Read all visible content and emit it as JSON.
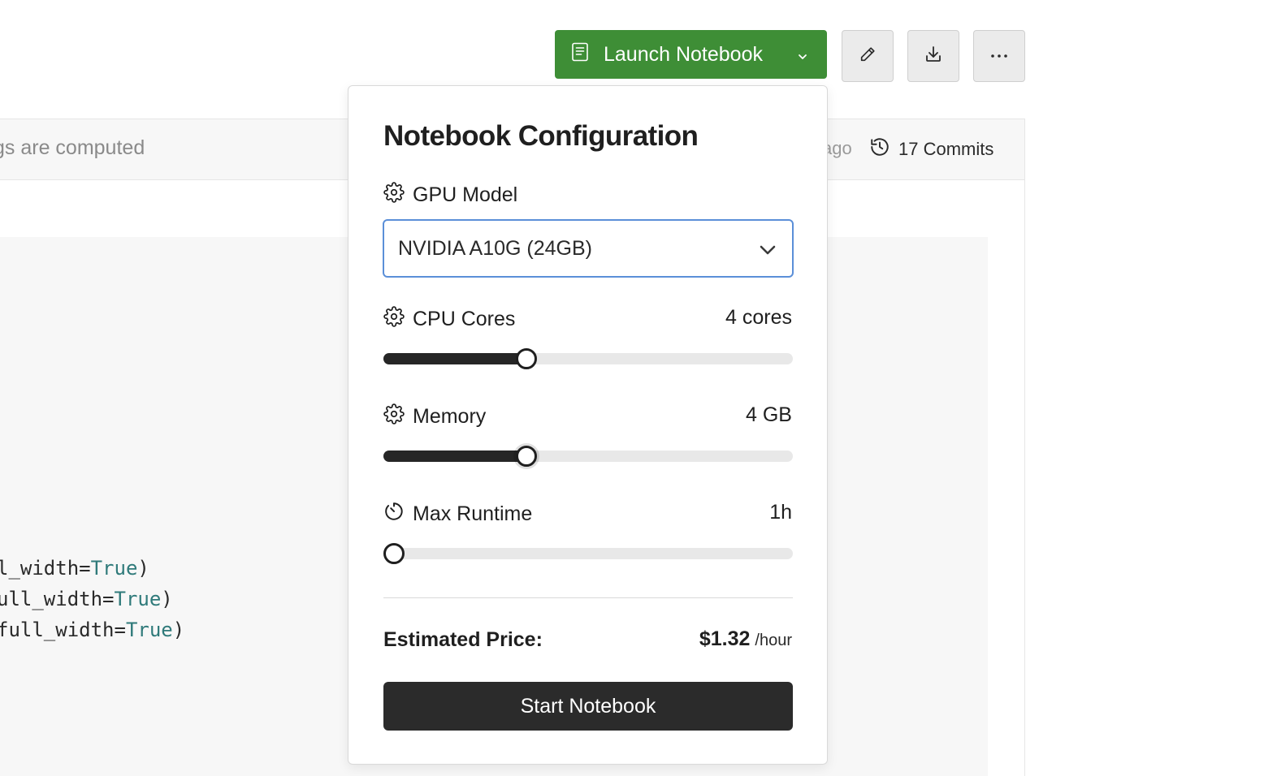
{
  "toolbar": {
    "launch_label": "Launch Notebook",
    "launch_color": "#3e8e36"
  },
  "background": {
    "info_text": "gs are computed",
    "info_ago": "ago",
    "commits_label": "17 Commits",
    "code_lines": [
      {
        "pre": "l_width=",
        "kw": "True",
        "post": ")"
      },
      {
        "pre": "ull_width=",
        "kw": "True",
        "post": ")"
      },
      {
        "pre": "full_width=",
        "kw": "True",
        "post": ")"
      }
    ]
  },
  "panel": {
    "title": "Notebook Configuration",
    "gpu": {
      "label": "GPU Model",
      "selected": "NVIDIA A10G (24GB)"
    },
    "cpu": {
      "label": "CPU Cores",
      "value_text": "4 cores",
      "slider_fraction": 0.34
    },
    "memory": {
      "label": "Memory",
      "value_text": "4 GB",
      "slider_fraction": 0.34
    },
    "runtime": {
      "label": "Max Runtime",
      "value_text": "1h",
      "slider_fraction": 0.0
    },
    "price": {
      "label": "Estimated Price:",
      "amount": "$1.32",
      "unit": "/hour"
    },
    "start_label": "Start Notebook"
  },
  "icons": {
    "launch": "notebook-icon",
    "launch_chevron": "chevron-down-icon",
    "edit": "pencil-icon",
    "download": "download-icon",
    "more": "more-horizontal-icon",
    "history": "history-icon",
    "settings": "gear-icon",
    "timer": "timer-icon"
  },
  "colors": {
    "accent_select_border": "#5b8fd8",
    "slider_fill": "#262626",
    "start_button": "#2b2b2b"
  }
}
